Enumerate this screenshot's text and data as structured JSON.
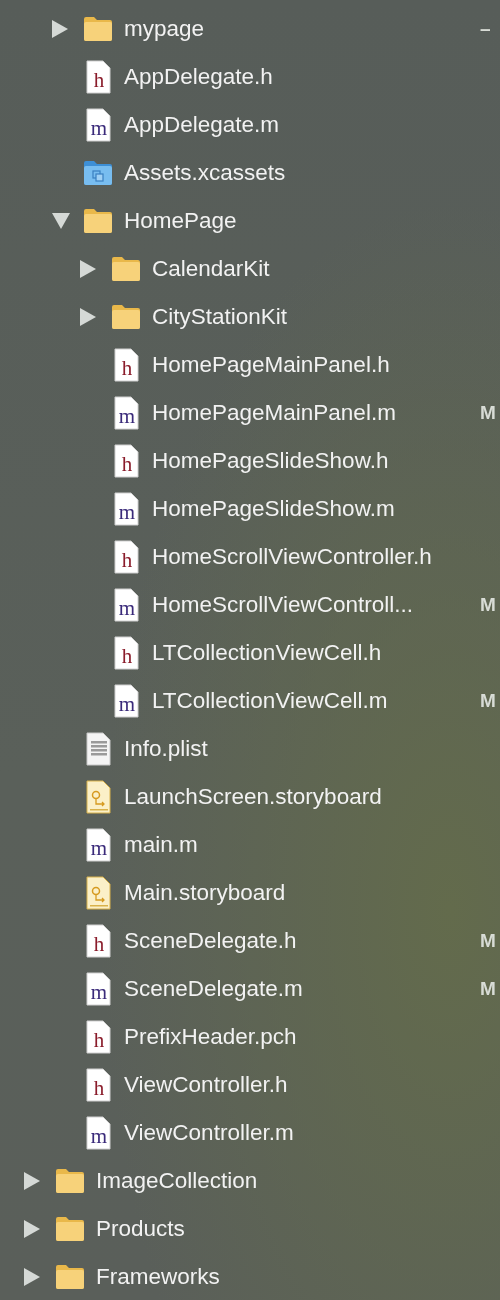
{
  "group_contents": [
    {
      "kind": "folder",
      "name": "mypage",
      "expanded": false,
      "status": "–"
    },
    {
      "kind": "header",
      "icon_letter": "h",
      "name": "AppDelegate.h"
    },
    {
      "kind": "source",
      "icon_letter": "m",
      "name": "AppDelegate.m"
    },
    {
      "kind": "assets",
      "name": "Assets.xcassets"
    },
    {
      "kind": "folder",
      "name": "HomePage",
      "expanded": true,
      "children": [
        {
          "kind": "folder",
          "name": "CalendarKit",
          "expanded": false
        },
        {
          "kind": "folder",
          "name": "CityStationKit",
          "expanded": false
        },
        {
          "kind": "header",
          "icon_letter": "h",
          "name": "HomePageMainPanel.h"
        },
        {
          "kind": "source",
          "icon_letter": "m",
          "name": "HomePageMainPanel.m",
          "status": "M"
        },
        {
          "kind": "header",
          "icon_letter": "h",
          "name": "HomePageSlideShow.h"
        },
        {
          "kind": "source",
          "icon_letter": "m",
          "name": "HomePageSlideShow.m"
        },
        {
          "kind": "header",
          "icon_letter": "h",
          "name": "HomeScrollViewController.h"
        },
        {
          "kind": "source",
          "icon_letter": "m",
          "name": "HomeScrollViewControll...",
          "status": "M"
        },
        {
          "kind": "header",
          "icon_letter": "h",
          "name": "LTCollectionViewCell.h"
        },
        {
          "kind": "source",
          "icon_letter": "m",
          "name": "LTCollectionViewCell.m",
          "status": "M"
        }
      ]
    },
    {
      "kind": "plist",
      "name": "Info.plist"
    },
    {
      "kind": "storyboard",
      "name": "LaunchScreen.storyboard"
    },
    {
      "kind": "source",
      "icon_letter": "m",
      "name": "main.m"
    },
    {
      "kind": "storyboard",
      "name": "Main.storyboard"
    },
    {
      "kind": "header",
      "icon_letter": "h",
      "name": "SceneDelegate.h",
      "status": "M"
    },
    {
      "kind": "source",
      "icon_letter": "m",
      "name": "SceneDelegate.m",
      "status": "M"
    },
    {
      "kind": "header",
      "icon_letter": "h",
      "name": "PrefixHeader.pch"
    },
    {
      "kind": "header",
      "icon_letter": "h",
      "name": "ViewController.h"
    },
    {
      "kind": "source",
      "icon_letter": "m",
      "name": "ViewController.m"
    }
  ],
  "top_level_items": [
    {
      "kind": "folder",
      "name": "ImageCollection",
      "expanded": false
    },
    {
      "kind": "folder",
      "name": "Products",
      "expanded": false
    },
    {
      "kind": "folder",
      "name": "Frameworks",
      "expanded": false
    }
  ]
}
